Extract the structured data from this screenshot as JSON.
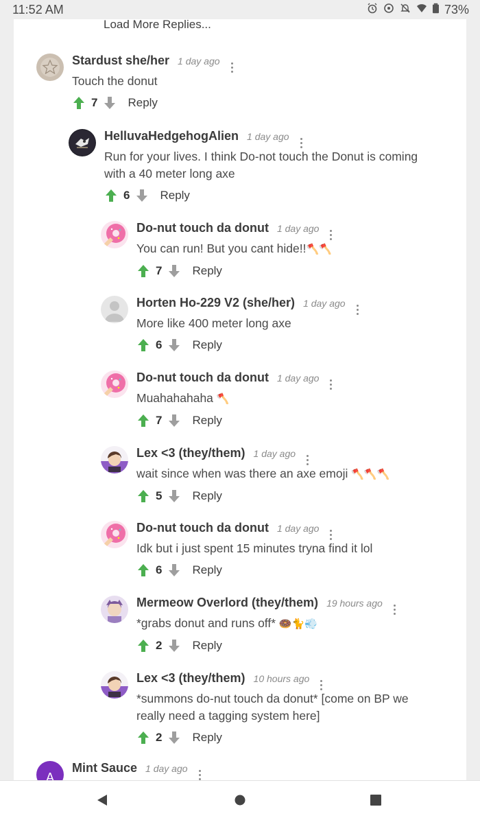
{
  "status": {
    "time": "11:52 AM",
    "battery": "73%",
    "icons": [
      "alarm-icon",
      "data-saver-icon",
      "notifications-off-icon",
      "wifi-icon",
      "battery-icon"
    ]
  },
  "thread": {
    "load_more": "Load More Replies...",
    "reply_label": "Reply",
    "comments": [
      {
        "user": "Stardust she/her",
        "time": "1 day ago",
        "text": "Touch the donut",
        "votes": "7",
        "avatar": "stardust-avatar"
      },
      {
        "user": "HelluvaHedgehogAlien",
        "time": "1 day ago",
        "text": "Run for your lives. I think Do-not touch the Donut is coming with a 40 meter long axe",
        "votes": "6",
        "avatar": "hedgehog-avatar"
      },
      {
        "user": "Do-nut touch da donut",
        "time": "1 day ago",
        "text": "You can run! But you cant hide!!",
        "emoji": "🪓🪓",
        "votes": "7",
        "avatar": "donut-avatar"
      },
      {
        "user": "Horten Ho-229 V2 (she/her)",
        "time": "1 day ago",
        "text": "More like 400 meter long axe",
        "votes": "6",
        "avatar": "default-avatar"
      },
      {
        "user": "Do-nut touch da donut",
        "time": "1 day ago",
        "text": "Muahahahaha",
        "emoji": "🪓",
        "votes": "7",
        "avatar": "donut-avatar"
      },
      {
        "user": "Lex <3 (they/them)",
        "time": "1 day ago",
        "text": "wait since when was there an axe emoji",
        "emoji": "🪓🪓🪓",
        "votes": "5",
        "avatar": "lex-avatar"
      },
      {
        "user": "Do-nut touch da donut",
        "time": "1 day ago",
        "text": "Idk but i just spent 15 minutes tryna find it lol",
        "votes": "6",
        "avatar": "donut-avatar"
      },
      {
        "user": "Mermeow Overlord (they/them)",
        "time": "19 hours ago",
        "text": "*grabs donut and runs off*",
        "emoji": "🍩🐈💨",
        "votes": "2",
        "avatar": "mermeow-avatar"
      },
      {
        "user": "Lex <3 (they/them)",
        "time": "10 hours ago",
        "text": "*summons do-nut touch da donut* [come on BP we really need a tagging system here]",
        "votes": "2",
        "avatar": "lex-avatar"
      },
      {
        "user": "Mint Sauce",
        "time": "1 day ago",
        "avatar_letter": "A",
        "avatar": "letter-avatar"
      }
    ]
  },
  "colors": {
    "upvote": "#4caf50",
    "downvote": "#9e9e9e",
    "letter_avatar": "#7b2fbe",
    "donut_pink": "#ef6fa8"
  },
  "nav": {
    "icons": [
      "back-icon",
      "home-icon",
      "recents-icon"
    ]
  }
}
